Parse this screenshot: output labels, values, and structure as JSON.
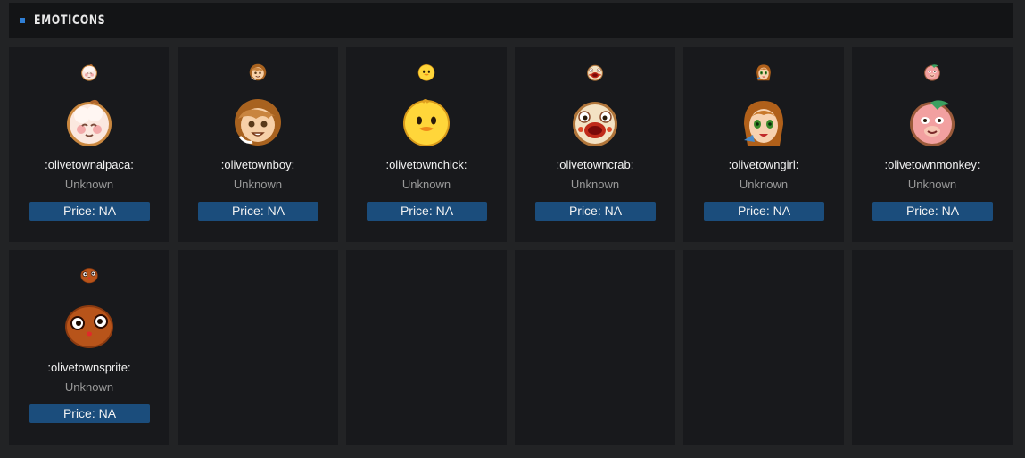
{
  "header": {
    "title": "EMOTICONS"
  },
  "accent_color": "#2f7fd6",
  "price_button_color": "#1b4d7c",
  "emoticons": [
    {
      "name": ":olivetownalpaca:",
      "status": "Unknown",
      "price": "Price: NA",
      "icon": "alpaca-icon"
    },
    {
      "name": ":olivetownboy:",
      "status": "Unknown",
      "price": "Price: NA",
      "icon": "boy-icon"
    },
    {
      "name": ":olivetownchick:",
      "status": "Unknown",
      "price": "Price: NA",
      "icon": "chick-icon"
    },
    {
      "name": ":olivetowncrab:",
      "status": "Unknown",
      "price": "Price: NA",
      "icon": "crab-icon"
    },
    {
      "name": ":olivetowngirl:",
      "status": "Unknown",
      "price": "Price: NA",
      "icon": "girl-icon"
    },
    {
      "name": ":olivetownmonkey:",
      "status": "Unknown",
      "price": "Price: NA",
      "icon": "monkey-icon"
    },
    {
      "name": ":olivetownsprite:",
      "status": "Unknown",
      "price": "Price: NA",
      "icon": "sprite-icon"
    }
  ]
}
